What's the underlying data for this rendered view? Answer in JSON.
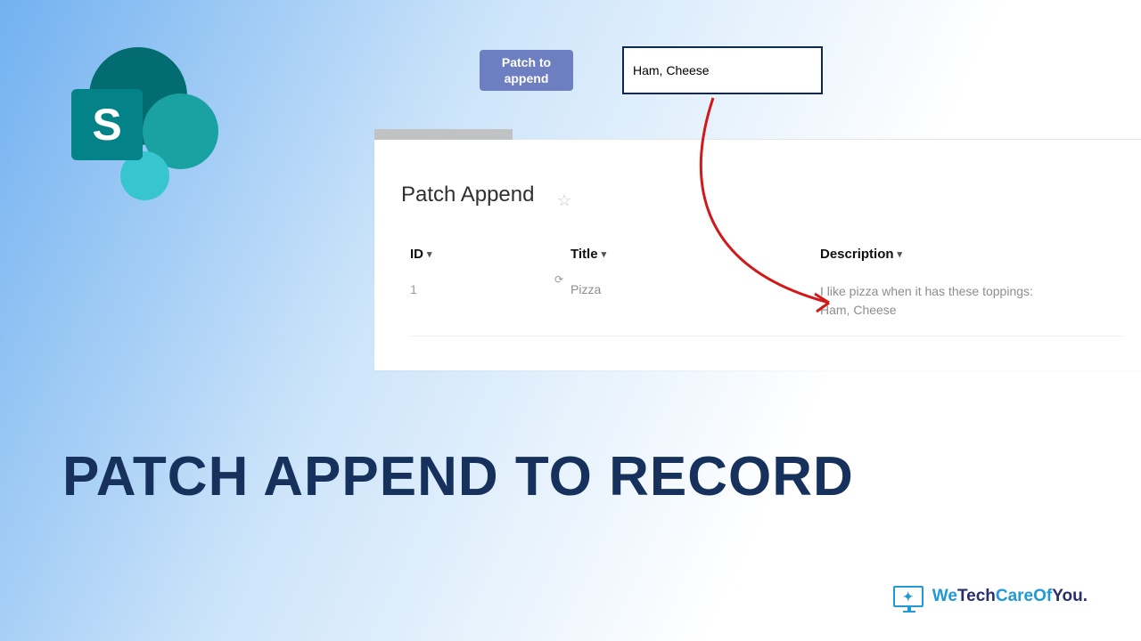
{
  "headline": "PATCH APPEND TO RECORD",
  "logo_letter": "S",
  "button": {
    "label": "Patch to\nappend"
  },
  "input": {
    "value": "Ham, Cheese"
  },
  "list": {
    "title": "Patch Append",
    "columns": {
      "id": "ID",
      "title": "Title",
      "description": "Description"
    },
    "rows": [
      {
        "id": "1",
        "title": "Pizza",
        "description": "I like pizza when it has these toppings:\nHam, Cheese"
      }
    ]
  },
  "brand": {
    "w1": "We",
    "w2": "Tech",
    "w3": "CareOf",
    "w4": "You."
  }
}
